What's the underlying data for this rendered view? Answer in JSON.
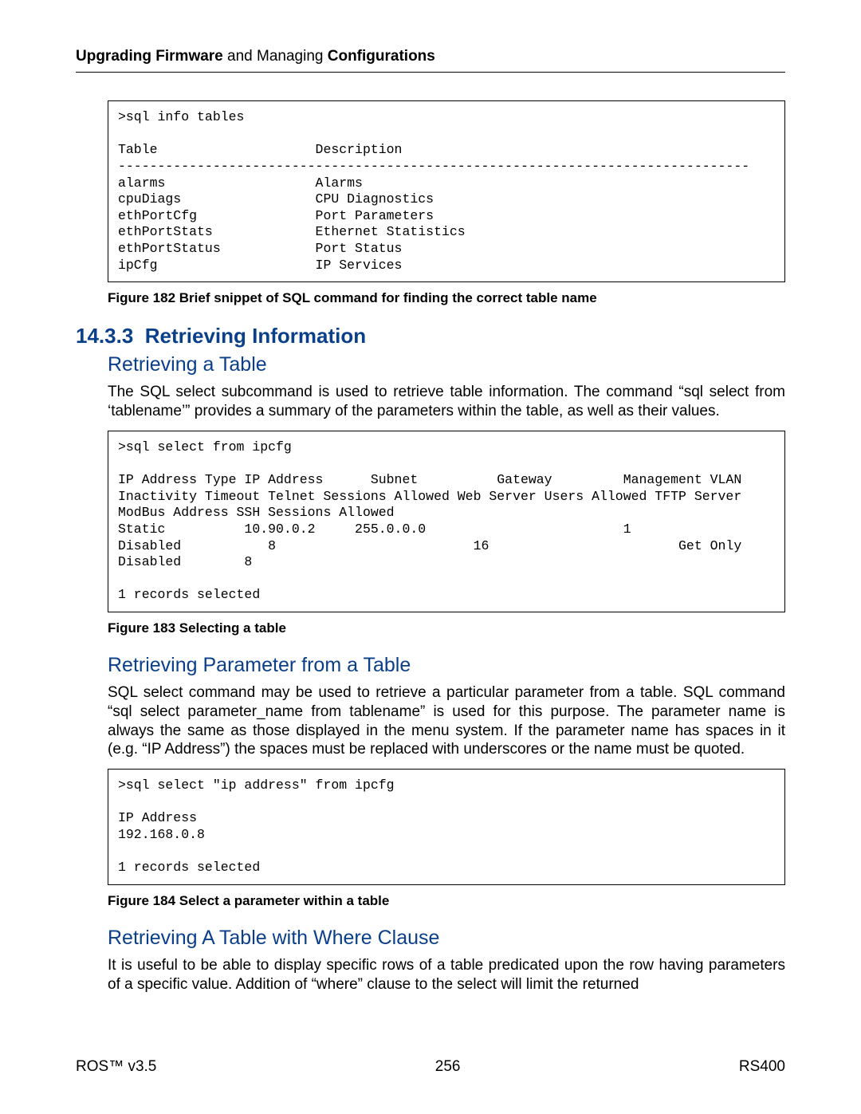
{
  "header": {
    "left_bold_1": "Upgrading Firmware",
    "left_plain": " and Managing ",
    "left_bold_2": "Configurations"
  },
  "code1": ">sql info tables\n\nTable                    Description\n--------------------------------------------------------------------------------\nalarms                   Alarms\ncpuDiags                 CPU Diagnostics\nethPortCfg               Port Parameters\nethPortStats             Ethernet Statistics\nethPortStatus            Port Status\nipCfg                    IP Services",
  "figcap1": "Figure 182 Brief snippet of SQL command for finding the correct table name",
  "section": {
    "number": "14.3.3",
    "title": "Retrieving Information"
  },
  "sub1": {
    "heading": "Retrieving a Table",
    "para": "The SQL select subcommand is used to retrieve table information. The command “sql select from ‘tablename’” provides a summary of the parameters within the table, as well as their values."
  },
  "code2": ">sql select from ipcfg\n\nIP Address Type IP Address      Subnet          Gateway         Management VLAN\nInactivity Timeout Telnet Sessions Allowed Web Server Users Allowed TFTP Server\nModBus Address SSH Sessions Allowed\nStatic          10.90.0.2     255.0.0.0                         1\nDisabled           8                         16                        Get Only\nDisabled        8\n\n1 records selected",
  "figcap2": "Figure 183 Selecting a table",
  "sub2": {
    "heading": "Retrieving Parameter from a Table",
    "para": "SQL select command may be used to retrieve a particular parameter from a table. SQL command “sql select parameter_name from tablename” is used for this purpose. The parameter name is always the same as those displayed in the menu system. If the parameter name has spaces in it (e.g. “IP Address”) the spaces must be replaced with underscores or the name must be quoted."
  },
  "code3": ">sql select \"ip address\" from ipcfg\n\nIP Address\n192.168.0.8\n\n1 records selected",
  "figcap3": "Figure 184 Select a parameter within a table",
  "sub3": {
    "heading": "Retrieving A Table with Where Clause",
    "para": "It is useful to be able to display specific rows of a table predicated upon the row having parameters of a specific value. Addition of “where” clause to the select will limit the returned"
  },
  "footer": {
    "left": "ROS™  v3.5",
    "center": "256",
    "right": "RS400"
  }
}
